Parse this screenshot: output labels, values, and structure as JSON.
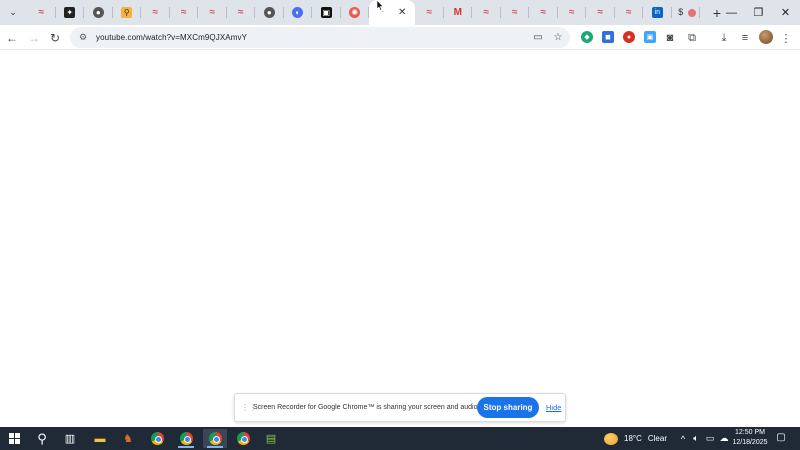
{
  "browser": {
    "tabs": [
      {
        "favicon": "wave-icon",
        "active": false
      },
      {
        "favicon": "dark-logo-icon",
        "active": false
      },
      {
        "favicon": "gray-circle-icon",
        "active": false
      },
      {
        "favicon": "yellow-logo-icon",
        "active": false
      },
      {
        "favicon": "wave-icon",
        "active": false
      },
      {
        "favicon": "wave-icon",
        "active": false
      },
      {
        "favicon": "wave-icon",
        "active": false
      },
      {
        "favicon": "wave-icon",
        "active": false
      },
      {
        "favicon": "gray-circle-icon",
        "active": false
      },
      {
        "favicon": "blue-logo-icon",
        "active": false
      },
      {
        "favicon": "black-logo-icon",
        "active": false
      },
      {
        "favicon": "red-logo-icon",
        "active": false
      },
      {
        "favicon": "active-tab-icon",
        "active": true
      },
      {
        "favicon": "wave-icon",
        "active": false
      },
      {
        "favicon": "gmail-icon",
        "active": false
      },
      {
        "favicon": "wave-icon",
        "active": false
      },
      {
        "favicon": "wave-icon",
        "active": false
      },
      {
        "favicon": "wave-icon",
        "active": false
      },
      {
        "favicon": "wave-icon",
        "active": false
      },
      {
        "favicon": "wave-icon",
        "active": false
      },
      {
        "favicon": "wave-icon",
        "active": false
      },
      {
        "favicon": "linkedin-icon",
        "active": false
      },
      {
        "favicon": "dollar-icon",
        "active": false
      }
    ],
    "address": {
      "url": "youtube.com/watch?v=MXCm9QJXAmvY"
    }
  },
  "screen_share": {
    "message": "Screen Recorder for Google Chrome™ is sharing your screen and audio.",
    "stop_label": "Stop sharing",
    "hide_label": "Hide"
  },
  "taskbar": {
    "weather": {
      "temp": "18°C",
      "condition": "Clear"
    },
    "clock": {
      "time": "12:50 PM",
      "date": "12/18/2025"
    }
  },
  "colors": {
    "accent": "#1a73e8",
    "tabstrip": "#dfe3ea",
    "taskbar": "#1f2a36"
  }
}
